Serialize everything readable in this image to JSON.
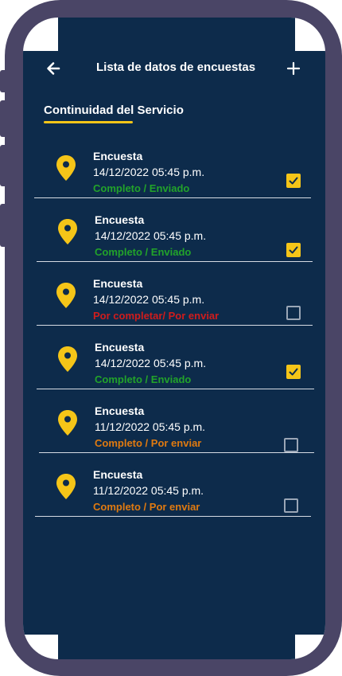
{
  "header": {
    "title": "Lista de datos de encuestas",
    "back_icon": "arrow-left-icon",
    "add_icon": "plus-icon"
  },
  "tab": {
    "label": "Continuidad del Servicio"
  },
  "colors": {
    "background": "#0d2b4b",
    "accent": "#f5c518",
    "status_sent": "#22a32a",
    "status_pending": "#d01c1c",
    "status_partial": "#e07a10"
  },
  "items": [
    {
      "title": "Encuesta",
      "date": "14/12/2022 05:45 p.m.",
      "status": "Completo / Enviado",
      "checked": true
    },
    {
      "title": "Encuesta",
      "date": "14/12/2022 05:45 p.m.",
      "status": "Completo / Enviado",
      "checked": true
    },
    {
      "title": "Encuesta",
      "date": "14/12/2022 05:45 p.m.",
      "status": "Por completar/ Por enviar",
      "checked": false
    },
    {
      "title": "Encuesta",
      "date": "14/12/2022 05:45 p.m.",
      "status": "Completo / Enviado",
      "checked": true
    },
    {
      "title": "Encuesta",
      "date": "11/12/2022 05:45 p.m.",
      "status": "Completo / Por enviar",
      "checked": false
    },
    {
      "title": "Encuesta",
      "date": "11/12/2022 05:45 p.m.",
      "status": "Completo / Por enviar",
      "checked": false
    }
  ]
}
